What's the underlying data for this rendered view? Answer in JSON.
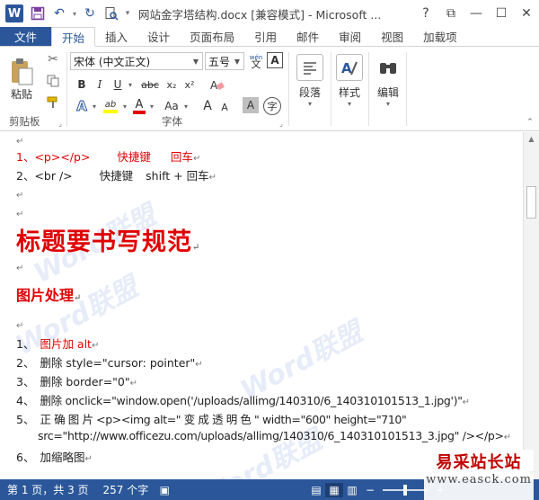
{
  "window": {
    "title": "网站金字塔结构.docx [兼容模式] - Microsoft ...",
    "help": "?",
    "controls": {
      "ribbon_display": "⧉",
      "minimize": "—",
      "maximize": "☐",
      "close": "✕"
    }
  },
  "quick_access": {
    "logo": "W",
    "save": "💾",
    "undo": "↶",
    "redo": "↻",
    "print_preview": "🔍",
    "more": "▾"
  },
  "tabs": [
    "文件",
    "开始",
    "插入",
    "设计",
    "页面布局",
    "引用",
    "邮件",
    "审阅",
    "视图",
    "加载项"
  ],
  "ribbon": {
    "clipboard": {
      "paste_label": "粘贴",
      "group_label": "剪贴板"
    },
    "font": {
      "font_name": "宋体 (中文正文)",
      "font_size": "五号",
      "wen": "wén",
      "bold": "B",
      "italic": "I",
      "underline": "U",
      "strike": "abc",
      "subscript": "x₂",
      "superscript": "x²",
      "text_effects": "A",
      "highlight": "ab",
      "font_color": "A",
      "change_case": "Aa",
      "grow": "A",
      "shrink": "A",
      "char_shading": "A",
      "enclose": "字",
      "group_label": "字体"
    },
    "paragraph": {
      "label": "段落"
    },
    "styles": {
      "label": "样式"
    },
    "editing": {
      "label": "编辑"
    }
  },
  "document": {
    "line1_num": "1、",
    "line1_tag": "<p></p>",
    "line1_key": "快捷键",
    "line1_val": "回车",
    "line2_num": "2、",
    "line2_tag": "<br />",
    "line2_key": "快捷键",
    "line2_val": "shift + 回车",
    "heading1": "标题要书写规范",
    "heading2": "图片处理",
    "items": [
      {
        "num": "1、",
        "text": "图片加 alt",
        "red": true
      },
      {
        "num": "2、",
        "text": "删除 style=\"cursor: pointer\"",
        "red": false
      },
      {
        "num": "3、",
        "text": "删除 border=\"0\"",
        "red": false
      },
      {
        "num": "4、",
        "text": "删除 onclick=\"window.open('/uploads/allimg/140310/6_140310101513_1.jpg')\"",
        "red": false
      }
    ],
    "item5_num": "5、",
    "item5_a": "正 确 图 片 <p><img  alt=\" 变 成 透 明 色 \"  width=\"600\"  height=\"710\"",
    "item5_b": "src=\"http://www.officezu.com/uploads/allimg/140310/6_140310101513_3.jpg\" /></p>",
    "item6_num": "6、",
    "item6_text": "加缩略图",
    "watermark": "Word联盟"
  },
  "status": {
    "page": "第 1 页，共 3 页",
    "words": "257 个字",
    "track_icon": "▣"
  },
  "site_mark": {
    "cn": "易采站长站",
    "en": "www.easck.com"
  },
  "colors": {
    "accent": "#2b579a",
    "heading_red": "#e00000"
  }
}
